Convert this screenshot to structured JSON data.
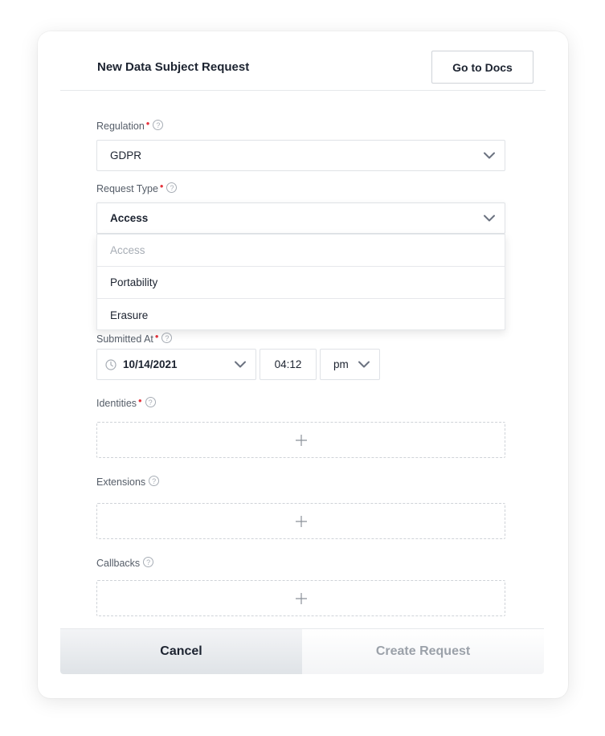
{
  "header": {
    "title": "New Data Subject Request",
    "docs_button": "Go to Docs"
  },
  "regulation": {
    "label": "Regulation",
    "value": "GDPR"
  },
  "request_type": {
    "label": "Request Type",
    "value": "Access",
    "options": [
      "Access",
      "Portability",
      "Erasure"
    ]
  },
  "submitted_at": {
    "label": "Submitted At",
    "date": "10/14/2021",
    "time": "04:12",
    "meridiem": "pm"
  },
  "identities": {
    "label": "Identities"
  },
  "extensions": {
    "label": "Extensions"
  },
  "callbacks": {
    "label": "Callbacks"
  },
  "footer": {
    "cancel_label": "Cancel",
    "create_label": "Create Request"
  },
  "colors": {
    "required": "#e5343d",
    "text": "#1c2330",
    "muted": "#a7adb5"
  },
  "icons": {
    "help": "help-icon",
    "chevron": "chevron-down-icon",
    "clock": "clock-icon",
    "plus": "plus-icon"
  }
}
